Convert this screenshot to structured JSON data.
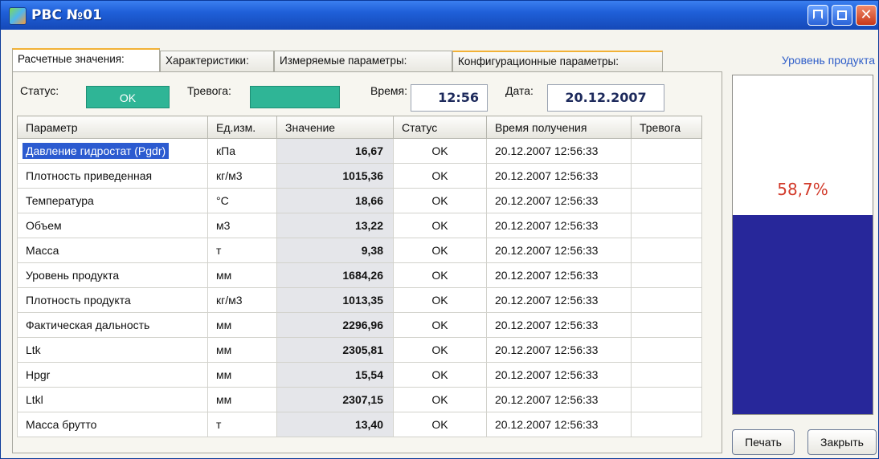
{
  "window": {
    "title": "РВС №01"
  },
  "tabs": [
    "Расчетные значения:",
    "Характеристики:",
    "Измеряемые параметры:",
    "Конфигурационные параметры:"
  ],
  "header": {
    "status_label": "Статус:",
    "status_value": "OK",
    "alarm_label": "Тревога:",
    "alarm_value": "",
    "time_label": "Время:",
    "time_value": "12:56",
    "date_label": "Дата:",
    "date_value": "20.12.2007"
  },
  "table": {
    "columns": [
      "Параметр",
      "Ед.изм.",
      "Значение",
      "Статус",
      "Время получения",
      "Тревога"
    ],
    "rows": [
      [
        "Давление гидростат (Pgdr)",
        "кПа",
        "16,67",
        "OK",
        "20.12.2007 12:56:33",
        ""
      ],
      [
        "Плотность приведенная",
        "кг/м3",
        "1015,36",
        "OK",
        "20.12.2007 12:56:33",
        ""
      ],
      [
        "Температура",
        "°C",
        "18,66",
        "OK",
        "20.12.2007 12:56:33",
        ""
      ],
      [
        "Объем",
        "м3",
        "13,22",
        "OK",
        "20.12.2007 12:56:33",
        ""
      ],
      [
        "Масса",
        "т",
        "9,38",
        "OK",
        "20.12.2007 12:56:33",
        ""
      ],
      [
        "Уровень продукта",
        "мм",
        "1684,26",
        "OK",
        "20.12.2007 12:56:33",
        ""
      ],
      [
        "Плотность продукта",
        "кг/м3",
        "1013,35",
        "OK",
        "20.12.2007 12:56:33",
        ""
      ],
      [
        "Фактическая дальность",
        "мм",
        "2296,96",
        "OK",
        "20.12.2007 12:56:33",
        ""
      ],
      [
        "Ltk",
        "мм",
        "2305,81",
        "OK",
        "20.12.2007 12:56:33",
        ""
      ],
      [
        "Hpgr",
        "мм",
        "15,54",
        "OK",
        "20.12.2007 12:56:33",
        ""
      ],
      [
        "Ltkl",
        "мм",
        "2307,15",
        "OK",
        "20.12.2007 12:56:33",
        ""
      ],
      [
        "Масса брутто",
        "т",
        "13,40",
        "OK",
        "20.12.2007 12:56:33",
        ""
      ]
    ]
  },
  "level": {
    "label": "Уровень продукта",
    "percent_text": "58,7%",
    "fill_fraction": 0.587
  },
  "buttons": {
    "print": "Печать",
    "close": "Закрыть"
  },
  "colors": {
    "status_ok": "#2fb596",
    "level_fill": "#27279a",
    "level_text": "#d23a2a",
    "titlebar": "#1f5fd8"
  }
}
